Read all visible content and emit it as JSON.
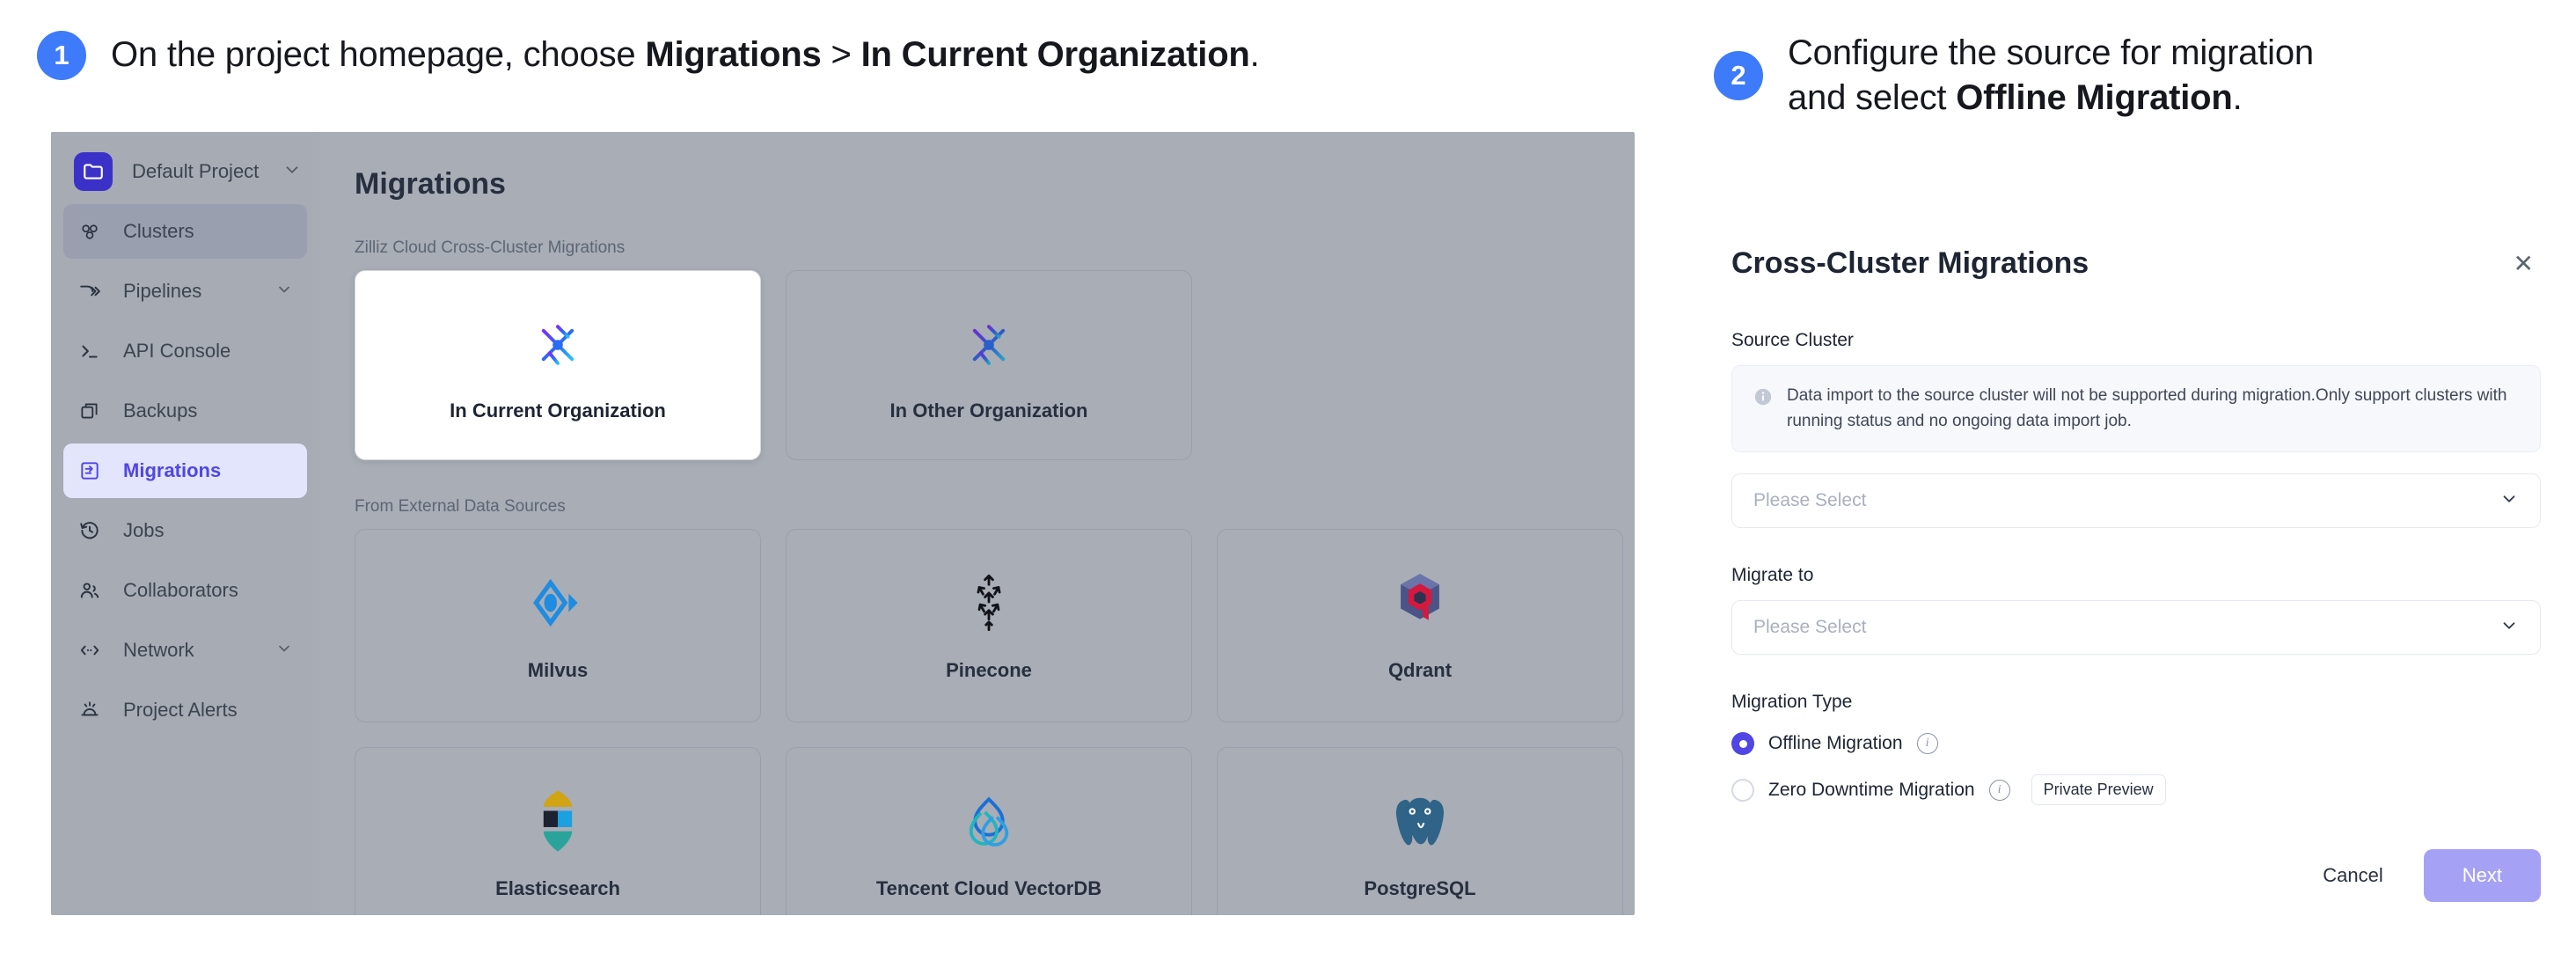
{
  "steps": [
    {
      "number": "1",
      "text_before": "On the project homepage, choose ",
      "bold1": "Migrations",
      "separator": " > ",
      "bold2": "In Current Organization",
      "text_after": "."
    },
    {
      "number": "2",
      "line1": "Configure the source for migration",
      "line2_before": "and select ",
      "line2_bold": "Offline Migration",
      "line2_after": "."
    }
  ],
  "screenshot": {
    "sidebar": {
      "project": {
        "label": "Default Project",
        "icon": "folder-icon",
        "chevron": "chevron-down-icon"
      },
      "items": [
        {
          "label": "Clusters",
          "icon": "clusters-icon",
          "state": "hover",
          "chevron": false
        },
        {
          "label": "Pipelines",
          "icon": "pipelines-icon",
          "state": "normal",
          "chevron": true
        },
        {
          "label": "API Console",
          "icon": "terminal-icon",
          "state": "normal",
          "chevron": false
        },
        {
          "label": "Backups",
          "icon": "backups-icon",
          "state": "normal",
          "chevron": false
        },
        {
          "label": "Migrations",
          "icon": "migrations-icon",
          "state": "active",
          "chevron": false
        },
        {
          "label": "Jobs",
          "icon": "jobs-icon",
          "state": "normal",
          "chevron": false
        },
        {
          "label": "Collaborators",
          "icon": "collaborators-icon",
          "state": "normal",
          "chevron": false
        },
        {
          "label": "Network",
          "icon": "network-icon",
          "state": "normal",
          "chevron": true
        },
        {
          "label": "Project Alerts",
          "icon": "alerts-icon",
          "state": "normal",
          "chevron": false
        }
      ]
    },
    "main": {
      "title": "Migrations",
      "section1_label": "Zilliz Cloud Cross-Cluster Migrations",
      "cross_cluster_cards": [
        {
          "name": "In Current Organization",
          "icon": "zilliz-star-icon",
          "selected": true
        },
        {
          "name": "In Other Organization",
          "icon": "zilliz-star-icon",
          "selected": false
        }
      ],
      "section2_label": "From External Data Sources",
      "source_cards": [
        {
          "name": "Milvus",
          "icon": "milvus-icon"
        },
        {
          "name": "Pinecone",
          "icon": "pinecone-icon"
        },
        {
          "name": "Qdrant",
          "icon": "qdrant-icon"
        },
        {
          "name": "Elasticsearch",
          "icon": "elasticsearch-icon"
        },
        {
          "name": "Tencent Cloud VectorDB",
          "icon": "tencent-cloud-icon"
        },
        {
          "name": "PostgreSQL",
          "icon": "postgresql-icon"
        }
      ]
    }
  },
  "dialog": {
    "title": "Cross-Cluster Migrations",
    "close_icon": "close-icon",
    "source_cluster": {
      "label": "Source Cluster",
      "alert_icon": "info-icon",
      "alert_text": "Data import to the source cluster will not be supported during migration.Only support clusters with running status and no ongoing data import job.",
      "placeholder": "Please Select",
      "value": ""
    },
    "migrate_to": {
      "label": "Migrate to",
      "placeholder": "Please Select",
      "value": ""
    },
    "migration_type": {
      "label": "Migration Type",
      "options": [
        {
          "label": "Offline Migration",
          "selected": true,
          "info_icon": "info-circle-icon",
          "badge": ""
        },
        {
          "label": "Zero Downtime Migration",
          "selected": false,
          "info_icon": "info-circle-icon",
          "badge": "Private Preview"
        }
      ]
    },
    "cancel_label": "Cancel",
    "next_label": "Next"
  },
  "colors": {
    "accent_blue": "#3e7bfa",
    "brand_indigo": "#4f46e5",
    "next_button": "#a5a2f5",
    "overlay_grey": "#a8adb6"
  }
}
